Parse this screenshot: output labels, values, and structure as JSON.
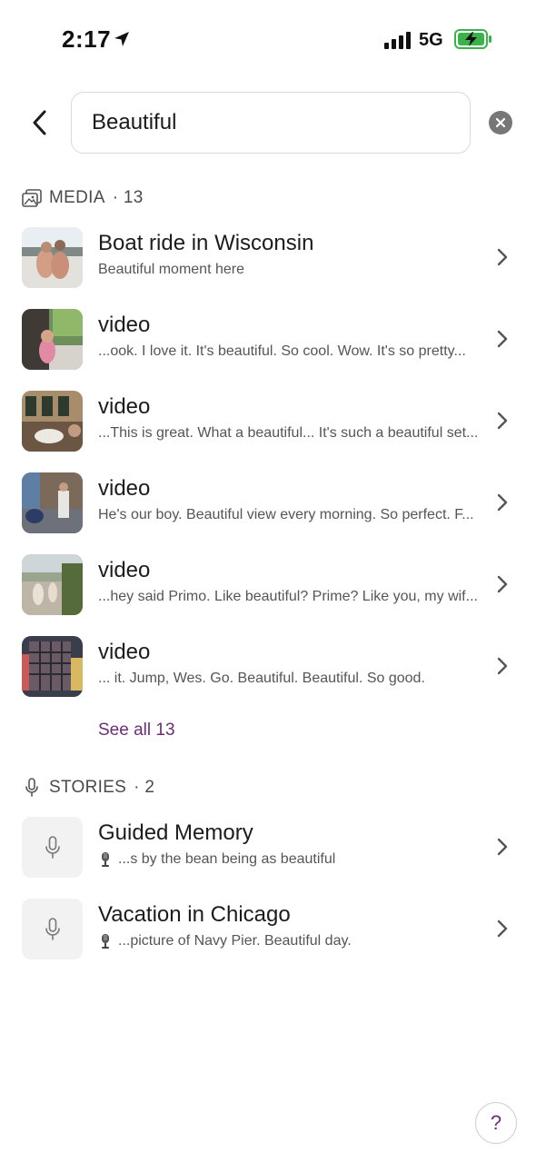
{
  "status_bar": {
    "time": "2:17",
    "network": "5G"
  },
  "search": {
    "value": "Beautiful"
  },
  "media_section": {
    "label": "MEDIA",
    "count_text": "· 13",
    "items": [
      {
        "title": "Boat ride in Wisconsin",
        "subtitle": "Beautiful moment here"
      },
      {
        "title": "video",
        "subtitle": "...ook. I love it. It's beautiful. So cool. Wow. It's so pretty..."
      },
      {
        "title": "video",
        "subtitle": "...This is great. What a beautiful... It's such a beautiful set..."
      },
      {
        "title": "video",
        "subtitle": "He's our boy. Beautiful view every morning. So perfect. F..."
      },
      {
        "title": "video",
        "subtitle": "...hey said Primo. Like beautiful? Prime? Like you, my wif..."
      },
      {
        "title": "video",
        "subtitle": "... it. Jump, Wes. Go. Beautiful. Beautiful. So good."
      }
    ],
    "see_all": "See all 13"
  },
  "stories_section": {
    "label": "STORIES",
    "count_text": "· 2",
    "items": [
      {
        "title": "Guided Memory",
        "subtitle": "...s by the bean being as beautiful"
      },
      {
        "title": "Vacation in Chicago",
        "subtitle": "...picture of Navy Pier. Beautiful day."
      }
    ]
  },
  "help": {
    "label": "?"
  },
  "colors": {
    "accent": "#6a2f74",
    "clear_button": "#777777",
    "thumb_bg": "#f2f2f2"
  },
  "icons": [
    "location-arrow-icon",
    "signal-icon",
    "battery-charging-icon",
    "back-chevron-icon",
    "clear-icon",
    "media-icon",
    "chevron-right-icon",
    "microphone-icon",
    "mic-emoji-icon",
    "help-icon"
  ]
}
